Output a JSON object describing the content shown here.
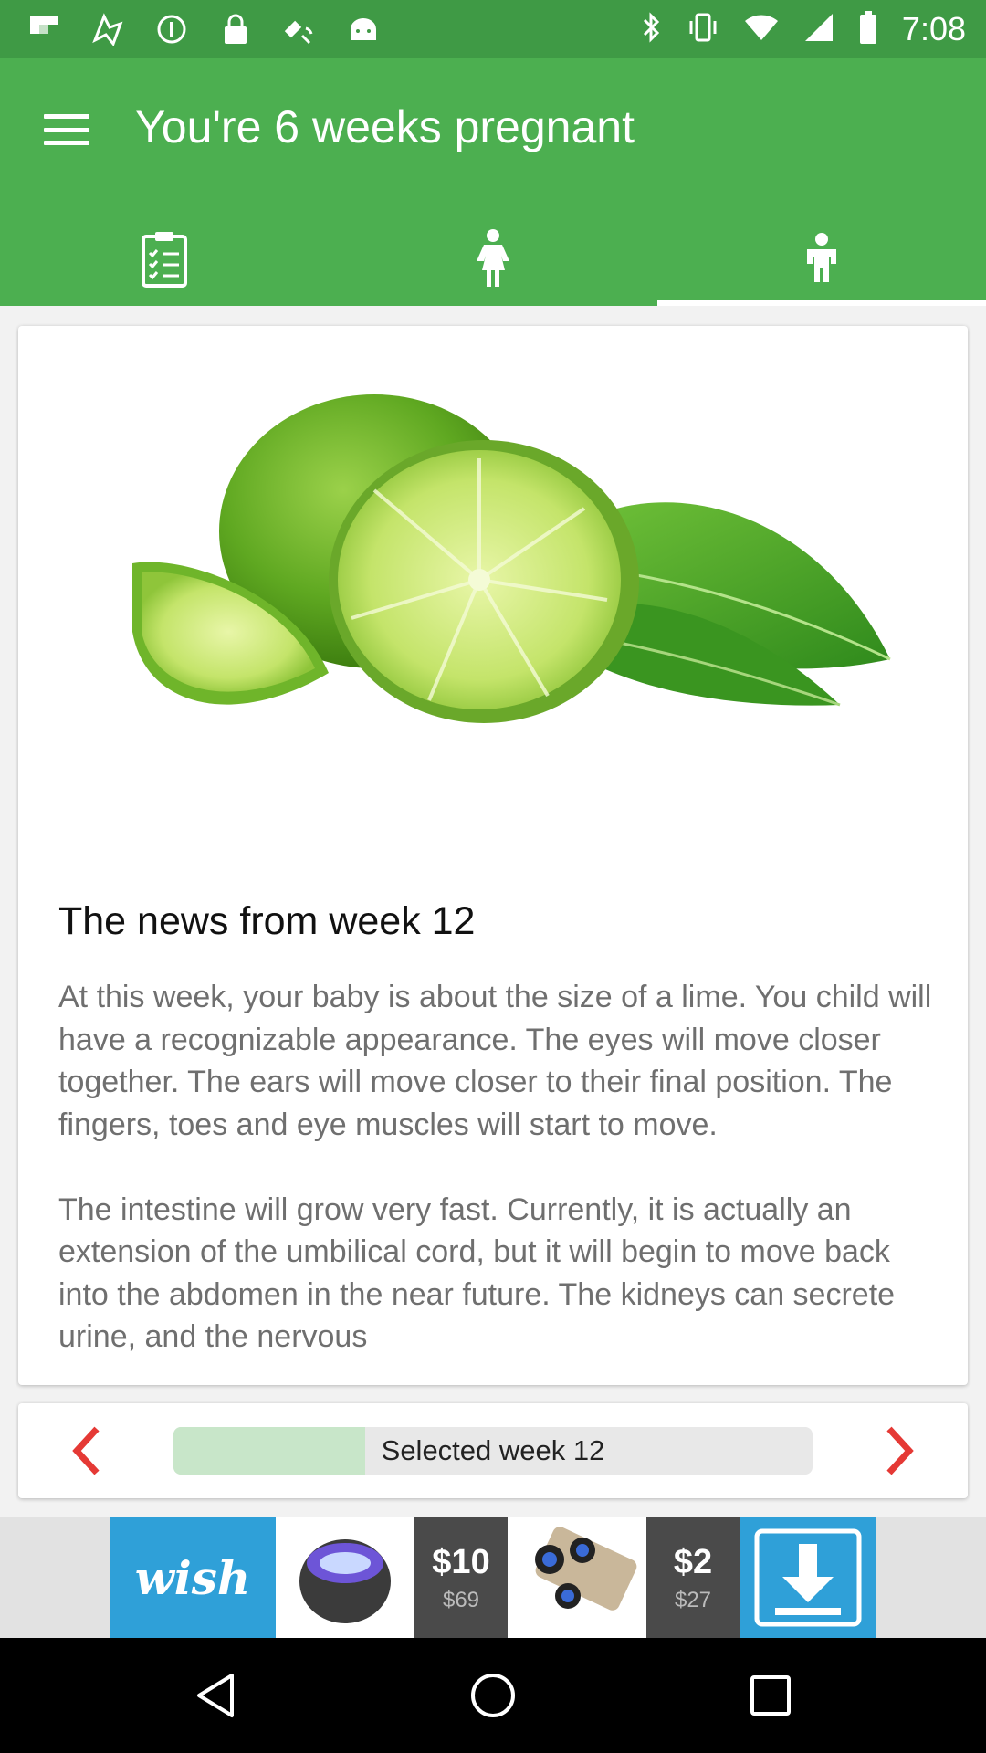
{
  "status_bar": {
    "time": "7:08",
    "icons": [
      "flipboard-icon",
      "maps-icon",
      "data-saver-icon",
      "lock-icon",
      "fake-gps-icon",
      "android-icon",
      "bluetooth-icon",
      "vibrate-icon",
      "wifi-icon",
      "signal-icon",
      "battery-icon"
    ]
  },
  "app_bar": {
    "title": "You're 6 weeks pregnant",
    "menu_icon": "hamburger-menu-icon",
    "tabs": [
      {
        "icon": "checklist-icon",
        "active": false
      },
      {
        "icon": "woman-icon",
        "active": false
      },
      {
        "icon": "child-icon",
        "active": true
      }
    ]
  },
  "article": {
    "image": "lime-image",
    "title": "The news from week 12",
    "body": "At this week, your baby is about the size of a lime. You child will have a recognizable appearance. The eyes will move closer together. The ears will move closer to their final position. The fingers, toes and eye muscles will start to move.\n\nThe intestine will grow very fast. Currently, it is actually an extension of the umbilical cord, but it will begin to move back into the abdomen in the near future. The kidneys can secrete urine, and the nervous"
  },
  "week_selector": {
    "label": "Selected week 12",
    "progress_fraction": 0.3,
    "prev_icon": "chevron-left-icon",
    "next_icon": "chevron-right-icon"
  },
  "ad": {
    "brand": "wish",
    "price1_now": "$10",
    "price1_was": "$69",
    "price2_now": "$2",
    "price2_was": "$27",
    "download_icon": "download-icon"
  },
  "colors": {
    "primary": "#4caf50",
    "status_bar": "#3f9a45",
    "accent": "#e53935",
    "progress_fill": "#c8e6c9",
    "ad_blue": "#2fa0d8"
  }
}
